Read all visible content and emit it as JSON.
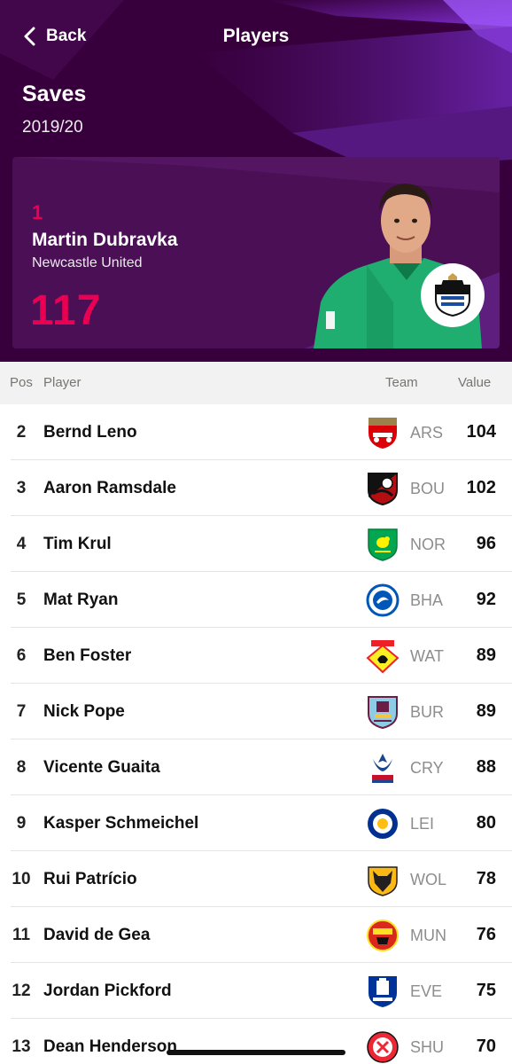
{
  "nav": {
    "back_label": "Back",
    "title": "Players"
  },
  "stat": {
    "name": "Saves",
    "season": "2019/20"
  },
  "leader": {
    "pos": "1",
    "player": "Martin Dubravka",
    "team": "Newcastle United",
    "value": "117",
    "crest_icon": "newcastle-crest-icon"
  },
  "table_header": {
    "pos": "Pos",
    "player": "Player",
    "team": "Team",
    "value": "Value"
  },
  "rows": [
    {
      "pos": "2",
      "player": "Bernd Leno",
      "abbr": "ARS",
      "value": "104",
      "crest": "arsenal-crest-icon"
    },
    {
      "pos": "3",
      "player": "Aaron Ramsdale",
      "abbr": "BOU",
      "value": "102",
      "crest": "bournemouth-crest-icon"
    },
    {
      "pos": "4",
      "player": "Tim Krul",
      "abbr": "NOR",
      "value": "96",
      "crest": "norwich-crest-icon"
    },
    {
      "pos": "5",
      "player": "Mat Ryan",
      "abbr": "BHA",
      "value": "92",
      "crest": "brighton-crest-icon"
    },
    {
      "pos": "6",
      "player": "Ben Foster",
      "abbr": "WAT",
      "value": "89",
      "crest": "watford-crest-icon"
    },
    {
      "pos": "7",
      "player": "Nick Pope",
      "abbr": "BUR",
      "value": "89",
      "crest": "burnley-crest-icon"
    },
    {
      "pos": "8",
      "player": "Vicente Guaita",
      "abbr": "CRY",
      "value": "88",
      "crest": "crystal-palace-crest-icon"
    },
    {
      "pos": "9",
      "player": "Kasper Schmeichel",
      "abbr": "LEI",
      "value": "80",
      "crest": "leicester-crest-icon"
    },
    {
      "pos": "10",
      "player": "Rui Patrício",
      "abbr": "WOL",
      "value": "78",
      "crest": "wolves-crest-icon"
    },
    {
      "pos": "11",
      "player": "David de Gea",
      "abbr": "MUN",
      "value": "76",
      "crest": "man-united-crest-icon"
    },
    {
      "pos": "12",
      "player": "Jordan Pickford",
      "abbr": "EVE",
      "value": "75",
      "crest": "everton-crest-icon"
    },
    {
      "pos": "13",
      "player": "Dean Henderson",
      "abbr": "SHU",
      "value": "70",
      "crest": "sheffield-united-crest-icon"
    }
  ],
  "colors": {
    "purple": "#37003c",
    "card": "#4a0f55",
    "accent": "#e90052"
  }
}
